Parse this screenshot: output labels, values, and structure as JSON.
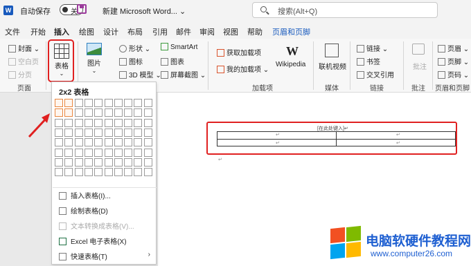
{
  "titlebar": {
    "logo": "W",
    "autosave_label": "自动保存",
    "autosave_state": "关",
    "doc_title": "新建 Microsoft Word... ⌄",
    "search_placeholder": "搜索(Alt+Q)"
  },
  "tabs": [
    "文件",
    "开始",
    "插入",
    "绘图",
    "设计",
    "布局",
    "引用",
    "邮件",
    "审阅",
    "视图",
    "帮助",
    "页眉和页脚"
  ],
  "active_tab": "插入",
  "ribbon": {
    "pages": {
      "cover": "封面",
      "blank": "空白页",
      "break": "分页",
      "group": "页面"
    },
    "table_button": {
      "label": "表格",
      "chevron": "⌄"
    },
    "illustrations": {
      "picture": "图片",
      "picture_chevron": "⌄",
      "shapes": "形状",
      "icons": "图标",
      "model3d": "3D 模型",
      "smartart": "SmartArt",
      "chart": "图表",
      "screenshot": "屏幕截图"
    },
    "addins": {
      "get": "获取加载项",
      "my": "我的加载项",
      "wiki": "Wikipedia",
      "wiki_icon_text": "W",
      "group": "加载项"
    },
    "media": {
      "video": "联机视频",
      "group": "媒体"
    },
    "links": {
      "link": "链接",
      "bookmark": "书签",
      "crossref": "交叉引用",
      "group": "链接"
    },
    "comments": {
      "comment": "批注",
      "group": "批注"
    },
    "headerfooter": {
      "header": "页眉",
      "footer": "页脚",
      "pagenum": "页码",
      "group": "页眉和页脚"
    }
  },
  "dropdown": {
    "title": "2x2 表格",
    "grid": {
      "cols": 10,
      "rows": 8,
      "selected_cols": 2,
      "selected_rows": 2
    },
    "items": [
      {
        "label": "插入表格(I)...",
        "disabled": false
      },
      {
        "label": "绘制表格(D)",
        "disabled": false
      },
      {
        "label": "文本转换成表格(V)...",
        "disabled": true
      },
      {
        "label": "Excel 电子表格(X)",
        "disabled": false
      },
      {
        "label": "快速表格(T)",
        "disabled": false,
        "submenu": true
      }
    ]
  },
  "document": {
    "table_caption": "[在此处键入]↵",
    "cell_mark": "↵"
  },
  "watermark": {
    "main": "电脑软硬件教程网",
    "url": "www.computer26.com",
    "colors": [
      "#f25022",
      "#7fba00",
      "#00a4ef",
      "#ffb900"
    ]
  },
  "colors": {
    "accent": "#185abd",
    "highlight": "#e02020",
    "grid_selected": "#e8853e"
  }
}
